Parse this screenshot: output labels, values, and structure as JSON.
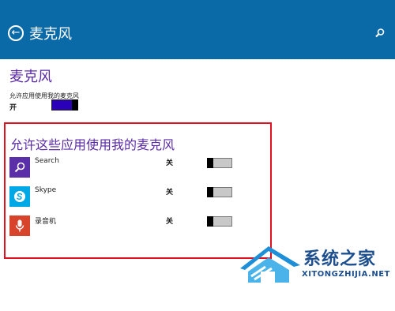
{
  "colors": {
    "header_bg": "#0a6aa8",
    "accent_purple": "#5a2aa8",
    "toggle_on_fill": "#2a00b8",
    "highlight_border": "#e01020",
    "search_icon_bg": "#5b2fa8",
    "skype_icon_bg": "#00a8e6",
    "recorder_icon_bg": "#d8432b"
  },
  "header": {
    "title": "麦克风",
    "back_icon": "back-arrow-icon",
    "search_icon": "search-icon"
  },
  "section": {
    "title": "麦克风",
    "setting_label": "允许应用使用我的麦克风",
    "setting_state": "开",
    "setting_on": true
  },
  "apps_section": {
    "title": "允许这些应用使用我的麦克风",
    "apps": [
      {
        "name": "Search",
        "state": "关",
        "icon": "search-icon",
        "on": false
      },
      {
        "name": "Skype",
        "state": "关",
        "icon": "skype-icon",
        "on": false
      },
      {
        "name": "录音机",
        "state": "关",
        "icon": "microphone-icon",
        "on": false
      }
    ]
  },
  "watermark": {
    "cn": "系统之家",
    "en": "XITONGZHIJIA.NET"
  }
}
